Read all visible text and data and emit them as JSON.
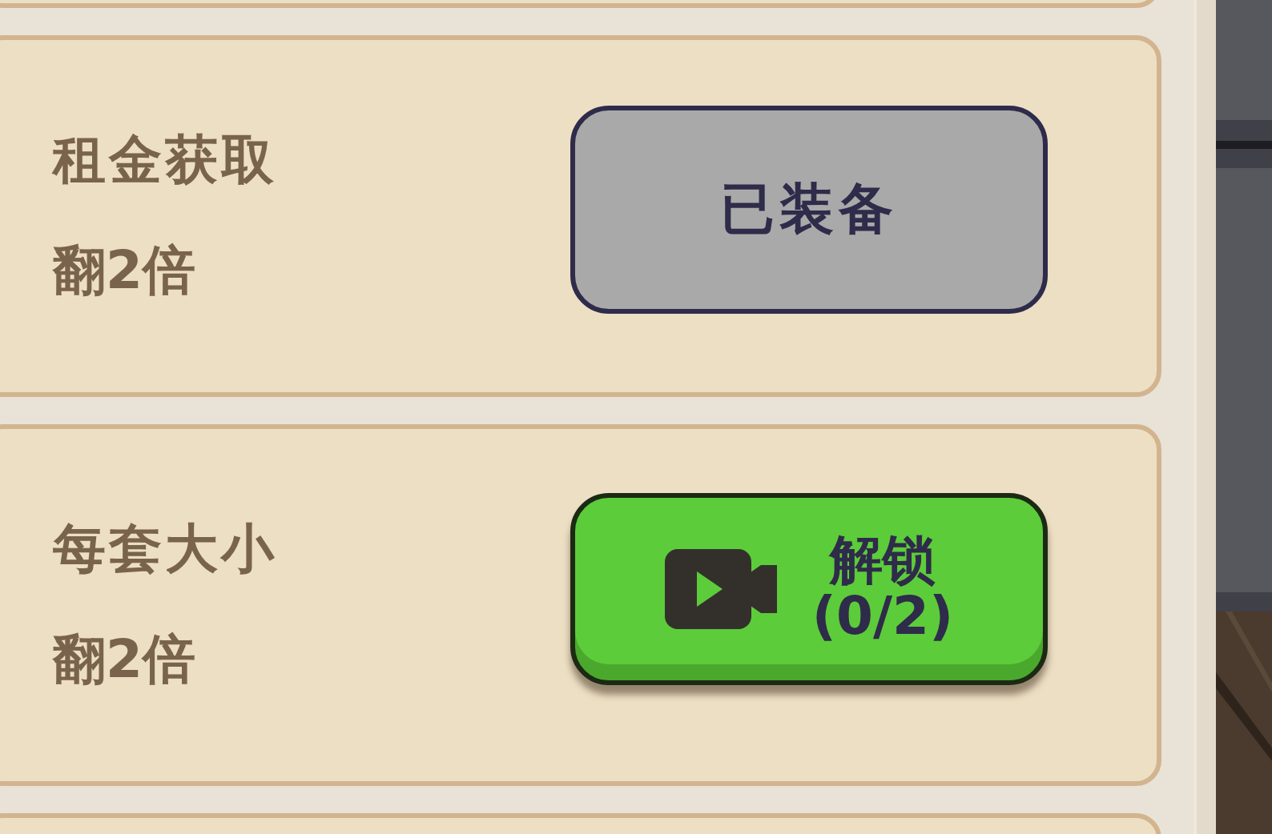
{
  "cards": [
    {
      "title": "租金获取",
      "effect": "翻2倍",
      "button": {
        "kind": "equipped",
        "label": "已装备"
      }
    },
    {
      "title": "每套大小",
      "effect": "翻2倍",
      "button": {
        "kind": "unlock",
        "label": "解锁",
        "progress": "(0/2)"
      }
    }
  ]
}
